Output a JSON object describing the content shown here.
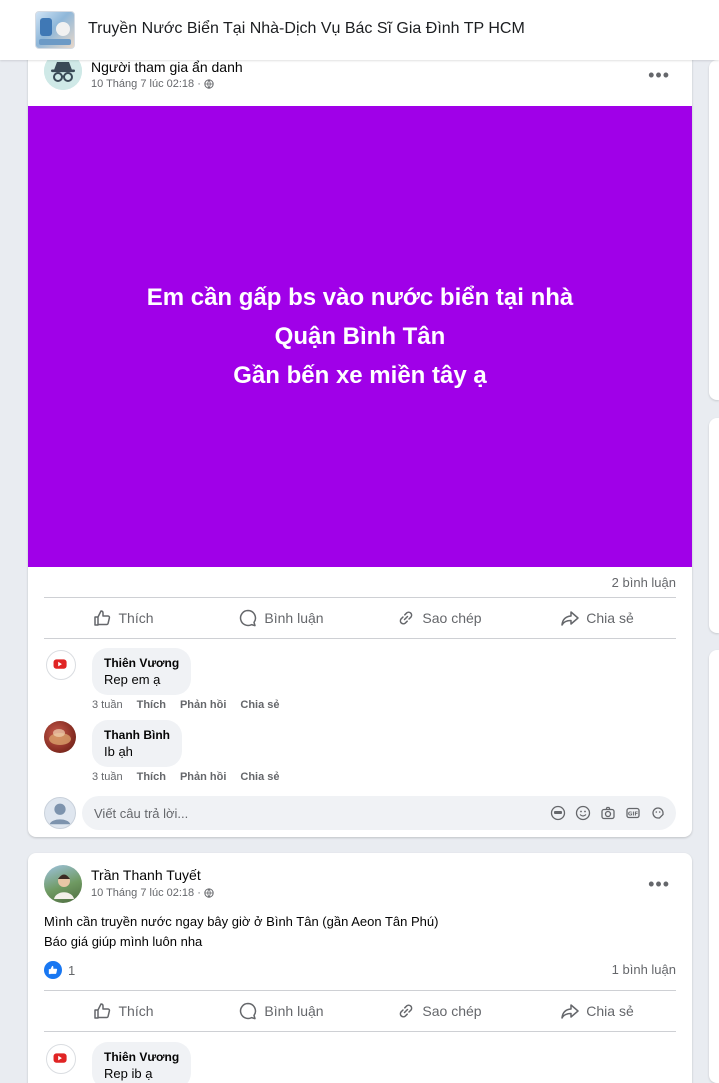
{
  "group": {
    "title": "Truyền Nước Biển Tại Nhà-Dịch Vụ Bác Sĩ Gia Đình TP HCM"
  },
  "actions": {
    "like": "Thích",
    "comment": "Bình luận",
    "copy": "Sao chép",
    "share": "Chia sẻ"
  },
  "reply_placeholder": "Viết câu trả lời...",
  "post1": {
    "author": "Người tham gia ẩn danh",
    "time": "10 Tháng 7 lúc 02:18 ·",
    "text": "Em cần gấp bs vào nước biển tại nhà\nQuận Bình Tân\nGần bến xe miền tây ạ",
    "background_color": "#a000e8",
    "comment_count": "2 bình luận",
    "comments": [
      {
        "name": "Thiên Vương",
        "text": "Rep em ạ",
        "time": "3 tuần",
        "like": "Thích",
        "reply": "Phản hồi",
        "share": "Chia sẻ"
      },
      {
        "name": "Thanh Bình",
        "text": "Ib ạh",
        "time": "3 tuần",
        "like": "Thích",
        "reply": "Phản hồi",
        "share": "Chia sẻ"
      }
    ]
  },
  "post2": {
    "author": "Trần Thanh Tuyết",
    "time": "10 Tháng 7 lúc 02:18 ·",
    "text": "Mình cần truyền nước ngay bây giờ ở Bình Tân (gần Aeon Tân Phú)\nBáo giá giúp mình luôn nha",
    "like_count": "1",
    "comment_count": "1 bình luận",
    "comments": [
      {
        "name": "Thiên Vương",
        "text": "Rep ib ạ"
      }
    ]
  }
}
